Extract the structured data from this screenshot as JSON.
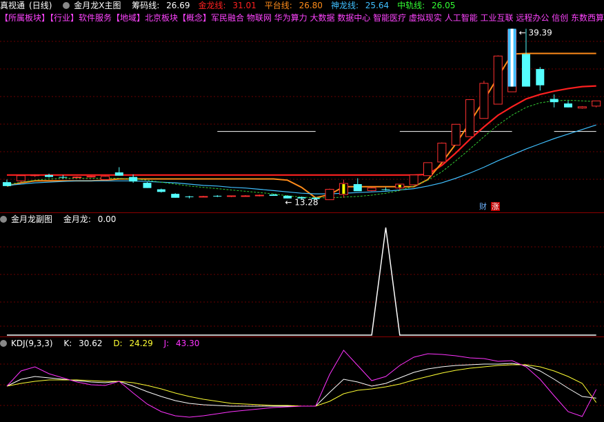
{
  "main": {
    "app_name": "真视通",
    "period": "(日线)",
    "indicator_name": "金月龙X主图",
    "legends": [
      {
        "label": "筹码线:",
        "value": "26.69",
        "color": "#ffffff"
      },
      {
        "label": "金龙线:",
        "value": "31.01",
        "color": "#ff2020"
      },
      {
        "label": "平台线:",
        "value": "26.80",
        "color": "#ff8c1a"
      },
      {
        "label": "神龙线:",
        "value": "25.64",
        "color": "#40c0ff"
      },
      {
        "label": "中轨线:",
        "value": "26.05",
        "color": "#33ff33"
      }
    ],
    "info_line": "【所属板块】【行业】软件服务【地域】北京板块【概念】军民融合 物联网 华为算力 大数据 数据中心 智能医疗 虚拟现实 人工智能 工业互联 远程办公 信创 东数西算",
    "high_label": "39.39",
    "low_label": "13.28",
    "badge_cai": "财",
    "badge_zhang": "涨"
  },
  "sub1": {
    "indicator_name": "金月龙副图",
    "legend_label": "金月龙:",
    "legend_value": "0.00"
  },
  "sub2": {
    "indicator_name": "KDJ(9,3,3)",
    "k_label": "K:",
    "k_value": "30.62",
    "d_label": "D:",
    "d_value": "24.29",
    "j_label": "J:",
    "j_value": "43.30"
  },
  "colors": {
    "up": "#ff3030",
    "down": "#54ffff",
    "signal": "#ffff00",
    "golden": "#ff2020",
    "platform": "#ff8c1a",
    "shenlong": "#40c0ff",
    "midrail": "#33cc33",
    "kline": "#ffffff",
    "dline": "#ffff33",
    "jline": "#ff33ff"
  },
  "chart_data": [
    {
      "type": "candlestick",
      "title": "金月龙X主图",
      "ylim": [
        12,
        40
      ],
      "x": [
        1,
        2,
        3,
        4,
        5,
        6,
        7,
        8,
        9,
        10,
        11,
        12,
        13,
        14,
        15,
        16,
        17,
        18,
        19,
        20,
        21,
        22,
        23,
        24,
        25,
        26,
        27,
        28,
        29,
        30,
        31,
        32,
        33,
        34,
        35,
        36,
        37,
        38,
        39,
        40,
        41,
        42,
        43
      ],
      "open": [
        15.8,
        16.0,
        16.8,
        16.9,
        16.6,
        16.6,
        16.6,
        16.2,
        17.3,
        16.6,
        15.7,
        14.7,
        14.0,
        13.6,
        13.6,
        13.7,
        13.6,
        13.7,
        13.7,
        13.9,
        13.7,
        13.5,
        13.4,
        13.1,
        13.9,
        15.5,
        14.5,
        14.7,
        14.9,
        15.4,
        16.8,
        18.9,
        21.5,
        22.8,
        25.6,
        27.8,
        29.7,
        35.5,
        33.2,
        28.6,
        27.9,
        27.2,
        27.5
      ],
      "high": [
        16.2,
        16.4,
        17.0,
        17.1,
        16.9,
        16.7,
        16.8,
        16.8,
        18.1,
        17.0,
        15.8,
        14.8,
        14.1,
        13.7,
        13.7,
        13.8,
        13.7,
        13.8,
        13.9,
        14.0,
        13.8,
        13.6,
        13.5,
        14.8,
        16.2,
        16.4,
        15.0,
        15.0,
        15.5,
        16.9,
        18.7,
        21.9,
        24.7,
        28.5,
        31.4,
        35.3,
        39.4,
        39.4,
        33.5,
        29.3,
        28.3,
        27.5,
        28.2
      ],
      "low": [
        15.3,
        15.7,
        16.6,
        16.5,
        16.3,
        16.5,
        16.5,
        16.1,
        16.8,
        15.7,
        14.9,
        14.2,
        13.4,
        13.3,
        13.5,
        13.5,
        13.5,
        13.6,
        13.6,
        13.7,
        13.3,
        13.2,
        13.3,
        13.1,
        13.4,
        14.5,
        14.4,
        14.5,
        14.5,
        15.3,
        16.8,
        18.8,
        21.5,
        22.8,
        25.6,
        27.8,
        29.7,
        30.5,
        29.9,
        27.3,
        27.3,
        27.1,
        27.3
      ],
      "close": [
        15.2,
        16.8,
        16.9,
        16.6,
        16.5,
        16.6,
        16.7,
        16.7,
        16.8,
        15.9,
        14.9,
        14.3,
        13.4,
        13.5,
        13.6,
        13.6,
        13.7,
        13.7,
        13.8,
        13.7,
        13.3,
        13.3,
        13.2,
        14.7,
        15.6,
        14.4,
        14.9,
        14.6,
        15.5,
        16.9,
        18.8,
        21.8,
        24.7,
        28.5,
        31.0,
        35.2,
        39.2,
        30.5,
        30.7,
        28.1,
        27.3,
        27.4,
        28.3
      ],
      "signal_days": [
        23,
        25,
        29
      ],
      "series": [
        {
          "name": "金龙线",
          "values": [
            16.9,
            16.9,
            16.9,
            16.9,
            16.9,
            16.9,
            16.9,
            16.9,
            16.9,
            16.9,
            16.9,
            16.9,
            16.9,
            16.9,
            16.9,
            16.9,
            16.9,
            16.9,
            16.9,
            16.9,
            16.9,
            16.9,
            16.9,
            16.9,
            16.9,
            16.9,
            16.9,
            16.9,
            16.9,
            16.9,
            17.0,
            18.4,
            20.3,
            22.4,
            24.3,
            26.1,
            27.4,
            28.6,
            29.3,
            29.8,
            30.2,
            30.5,
            30.6
          ]
        },
        {
          "name": "平台线",
          "values": [
            15.2,
            15.7,
            16.0,
            16.0,
            16.0,
            16.0,
            16.0,
            16.1,
            16.3,
            16.3,
            16.3,
            16.3,
            16.3,
            16.3,
            16.3,
            16.3,
            16.3,
            16.3,
            16.3,
            16.3,
            16.1,
            15.0,
            13.4,
            13.9,
            15.1,
            15.1,
            15.1,
            15.1,
            15.1,
            15.1,
            16.2,
            18.8,
            21.7,
            25.0,
            28.4,
            32.0,
            35.5,
            35.6,
            35.6,
            35.6,
            35.6,
            35.6,
            35.6
          ]
        },
        {
          "name": "神龙线",
          "values": [
            15.3,
            15.5,
            15.7,
            15.8,
            15.9,
            16.0,
            16.0,
            16.0,
            16.0,
            16.0,
            15.9,
            15.8,
            15.7,
            15.5,
            15.3,
            15.2,
            15.0,
            14.9,
            14.7,
            14.5,
            14.3,
            14.1,
            14.0,
            14.0,
            14.1,
            14.2,
            14.3,
            14.4,
            14.6,
            14.8,
            15.2,
            15.7,
            16.4,
            17.2,
            18.1,
            19.1,
            20.0,
            20.9,
            21.7,
            22.5,
            23.2,
            23.9,
            24.6
          ]
        },
        {
          "name": "中轨线",
          "values": [
            15.4,
            15.8,
            16.1,
            16.3,
            16.4,
            16.4,
            16.4,
            16.4,
            16.4,
            16.3,
            16.1,
            15.8,
            15.5,
            15.2,
            15.0,
            14.8,
            14.6,
            14.4,
            14.2,
            14.0,
            13.7,
            13.5,
            13.4,
            13.4,
            13.5,
            13.6,
            13.8,
            14.1,
            14.5,
            15.2,
            16.1,
            17.4,
            19.1,
            20.9,
            22.8,
            24.6,
            26.1,
            27.3,
            28.0,
            28.3,
            28.4,
            28.3,
            28.2
          ]
        }
      ],
      "flat_lines": [
        {
          "y": 23.6,
          "x0": 16,
          "x1": 23
        },
        {
          "y": 23.6,
          "x0": 29,
          "x1": 37
        },
        {
          "y": 23.6,
          "x0": 40,
          "x1": 43
        }
      ],
      "annotations": [
        {
          "text": "39.39",
          "x": 37,
          "y": 39.4
        },
        {
          "text": "13.28",
          "x": 22,
          "y": 13.3
        }
      ]
    },
    {
      "type": "line",
      "title": "金月龙副图",
      "ylim": [
        0,
        100
      ],
      "x": [
        1,
        2,
        3,
        4,
        5,
        6,
        7,
        8,
        9,
        10,
        11,
        12,
        13,
        14,
        15,
        16,
        17,
        18,
        19,
        20,
        21,
        22,
        23,
        24,
        25,
        26,
        27,
        28,
        29,
        30,
        31,
        32,
        33,
        34,
        35,
        36,
        37,
        38,
        39,
        40,
        41,
        42,
        43
      ],
      "series": [
        {
          "name": "金月龙",
          "values": [
            0,
            0,
            0,
            0,
            0,
            0,
            0,
            0,
            0,
            0,
            0,
            0,
            0,
            0,
            0,
            0,
            0,
            0,
            0,
            0,
            0,
            0,
            0,
            0,
            0,
            0,
            0,
            0,
            0,
            0,
            0,
            0,
            0,
            0,
            0,
            0,
            0,
            0,
            0,
            0,
            0,
            0,
            0
          ]
        }
      ],
      "spike": {
        "x": 28,
        "value": 100
      }
    },
    {
      "type": "line",
      "title": "KDJ(9,3,3)",
      "ylim": [
        0,
        100
      ],
      "x": [
        1,
        2,
        3,
        4,
        5,
        6,
        7,
        8,
        9,
        10,
        11,
        12,
        13,
        14,
        15,
        16,
        17,
        18,
        19,
        20,
        21,
        22,
        23,
        24,
        25,
        26,
        27,
        28,
        29,
        30,
        31,
        32,
        33,
        34,
        35,
        36,
        37,
        38,
        39,
        40,
        41,
        42,
        43
      ],
      "series": [
        {
          "name": "K",
          "values": [
            48,
            58,
            62,
            60,
            58,
            56,
            54,
            53,
            55,
            48,
            40,
            33,
            27,
            23,
            21,
            20,
            19,
            19,
            19,
            19,
            19,
            19,
            19,
            39,
            58,
            54,
            48,
            52,
            60,
            68,
            73,
            76,
            78,
            79,
            80,
            80,
            81,
            78,
            70,
            58,
            45,
            33,
            30.62
          ]
        },
        {
          "name": "D",
          "values": [
            48,
            52,
            55,
            57,
            57,
            57,
            56,
            55,
            55,
            53,
            49,
            44,
            38,
            33,
            29,
            26,
            23,
            22,
            21,
            20,
            20,
            19,
            19,
            26,
            37,
            42,
            44,
            47,
            51,
            57,
            62,
            67,
            71,
            74,
            76,
            78,
            79,
            79,
            76,
            70,
            62,
            52,
            24.29
          ]
        },
        {
          "name": "J",
          "values": [
            48,
            70,
            76,
            66,
            60,
            54,
            50,
            49,
            55,
            38,
            22,
            11,
            5,
            3,
            5,
            8,
            11,
            13,
            15,
            17,
            18,
            19,
            19,
            65,
            100,
            78,
            56,
            62,
            78,
            90,
            95,
            94,
            92,
            89,
            88,
            84,
            85,
            76,
            58,
            34,
            11,
            4,
            43.3
          ]
        }
      ]
    }
  ]
}
